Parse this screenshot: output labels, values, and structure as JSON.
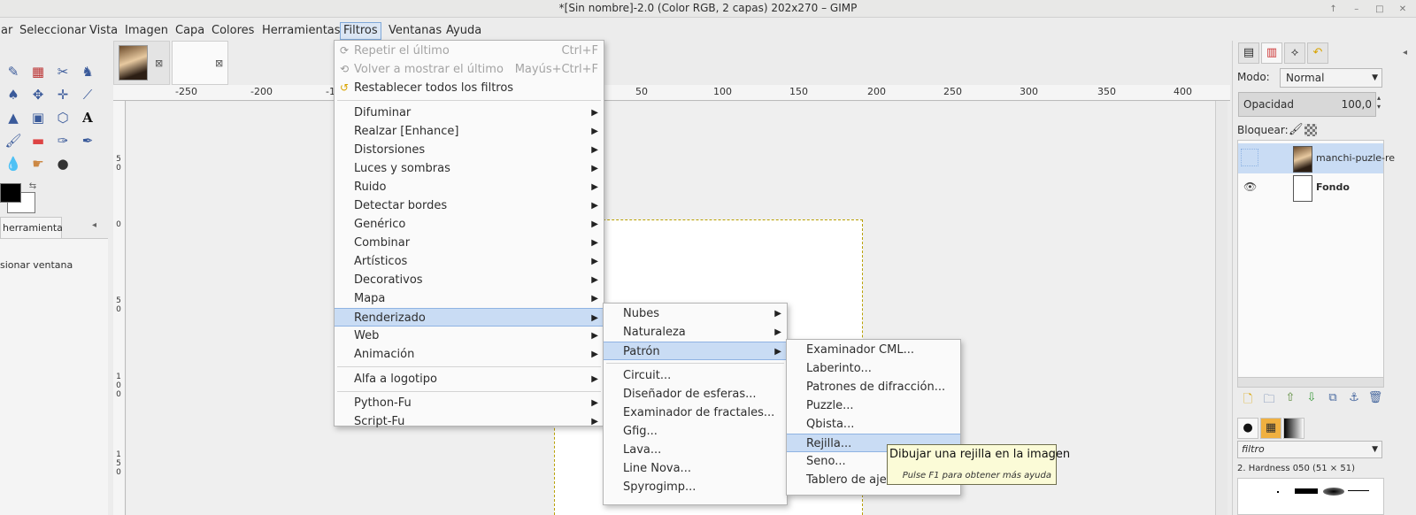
{
  "window": {
    "title": "*[Sin nombre]-2.0 (Color RGB, 2 capas) 202x270 – GIMP",
    "controls": [
      "↑",
      "–",
      "□",
      "✕"
    ]
  },
  "menubar": {
    "items": [
      "ar",
      "Seleccionar",
      "Vista",
      "Imagen",
      "Capa",
      "Colores",
      "Herramientas",
      "Filtros",
      "Ventanas",
      "Ayuda"
    ],
    "active": "Filtros"
  },
  "toolbox": {
    "tab_label": "herramienta",
    "options_text": "sionar ventana"
  },
  "ruler": {
    "top_ticks": [
      "-250",
      "-200",
      "-1",
      "50",
      "100",
      "150",
      "200",
      "250",
      "300",
      "350",
      "400"
    ],
    "left_ticks": [
      "5",
      "0",
      "0",
      "5",
      "0",
      "1",
      "0",
      "0",
      "1",
      "5",
      "0"
    ]
  },
  "filters_menu": {
    "repeat_last": {
      "label": "Repetir el último",
      "shortcut": "Ctrl+F"
    },
    "reshow_last": {
      "label": "Volver a mostrar el último",
      "shortcut": "Mayús+Ctrl+F"
    },
    "reset_all": "Restablecer todos los filtros",
    "items": [
      "Difuminar",
      "Realzar [Enhance]",
      "Distorsiones",
      "Luces y sombras",
      "Ruido",
      "Detectar bordes",
      "Genérico",
      "Combinar",
      "Artísticos",
      "Decorativos",
      "Mapa",
      "Renderizado",
      "Web",
      "Animación"
    ],
    "alpha_logo": "Alfa a logotipo",
    "python_fu": "Python-Fu",
    "script_fu": "Script-Fu"
  },
  "render_menu": {
    "items": [
      "Nubes",
      "Naturaleza",
      "Patrón"
    ],
    "plugins": [
      "Circuit...",
      "Diseñador de esferas...",
      "Examinador de fractales...",
      "Gfig...",
      "Lava...",
      "Line Nova...",
      "Spyrogimp..."
    ]
  },
  "pattern_menu": {
    "items": [
      "Examinador CML...",
      "Laberinto...",
      "Patrones de difracción...",
      "Puzzle...",
      "Qbista...",
      "Rejilla...",
      "Seno...",
      "Tablero de ajedr"
    ]
  },
  "tooltip": {
    "text": "Dibujar una rejilla en la imagen",
    "help": "Pulse F1 para obtener más ayuda"
  },
  "layers_dock": {
    "mode_label": "Modo:",
    "mode_value": "Normal",
    "opacity_label": "Opacidad",
    "opacity_value": "100,0",
    "lock_label": "Bloquear:",
    "layers": [
      {
        "name": "manchi-puzle-re",
        "visible": false,
        "selected": true
      },
      {
        "name": "Fondo",
        "visible": true,
        "selected": false
      }
    ]
  },
  "brushes_dock": {
    "filter_placeholder": "filtro",
    "brush_name": "2. Hardness 050 (51 × 51)"
  },
  "colors": {
    "highlight": "#c9dcf4",
    "tooltip_bg": "#fbfbd7",
    "fg": "#000000",
    "bg": "#ffffff"
  }
}
